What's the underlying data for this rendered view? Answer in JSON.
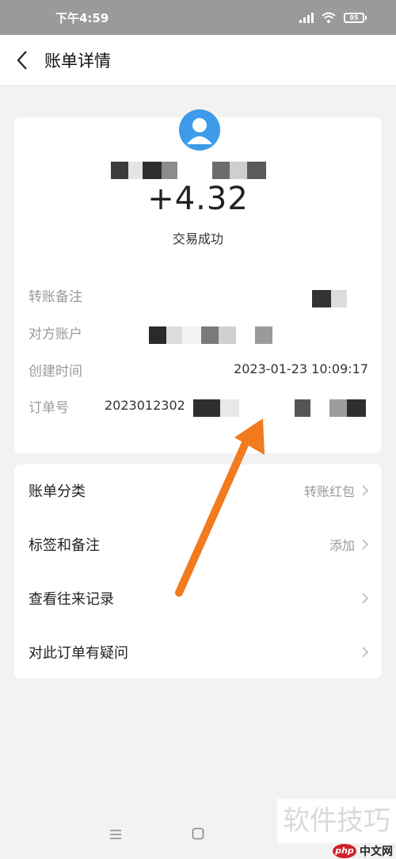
{
  "status_bar": {
    "time": "下午4:59",
    "battery": "95"
  },
  "header": {
    "title": "账单详情"
  },
  "transaction": {
    "amount": "+4.32",
    "status": "交易成功",
    "details": [
      {
        "label": "转账备注",
        "value": ""
      },
      {
        "label": "对方账户",
        "value": ""
      },
      {
        "label": "创建时间",
        "value": "2023-01-23 10:09:17"
      },
      {
        "label": "订单号",
        "value": "2023012302"
      }
    ]
  },
  "menu": [
    {
      "label": "账单分类",
      "value": "转账红包"
    },
    {
      "label": "标签和备注",
      "value": "添加"
    },
    {
      "label": "查看往来记录",
      "value": ""
    },
    {
      "label": "对此订单有疑问",
      "value": ""
    }
  ],
  "watermark": {
    "text": "软件技巧",
    "logo_php": "php",
    "logo_cn": "中文网"
  },
  "colors": {
    "accent_blue": "#3d9be9",
    "arrow_orange": "#f27a1f",
    "status_bar": "#9a9a9a"
  },
  "icons": [
    "back-icon",
    "avatar-icon",
    "chevron-right-icon",
    "menu-icon",
    "home-icon",
    "wifi-icon",
    "signal-icon",
    "battery-icon"
  ]
}
